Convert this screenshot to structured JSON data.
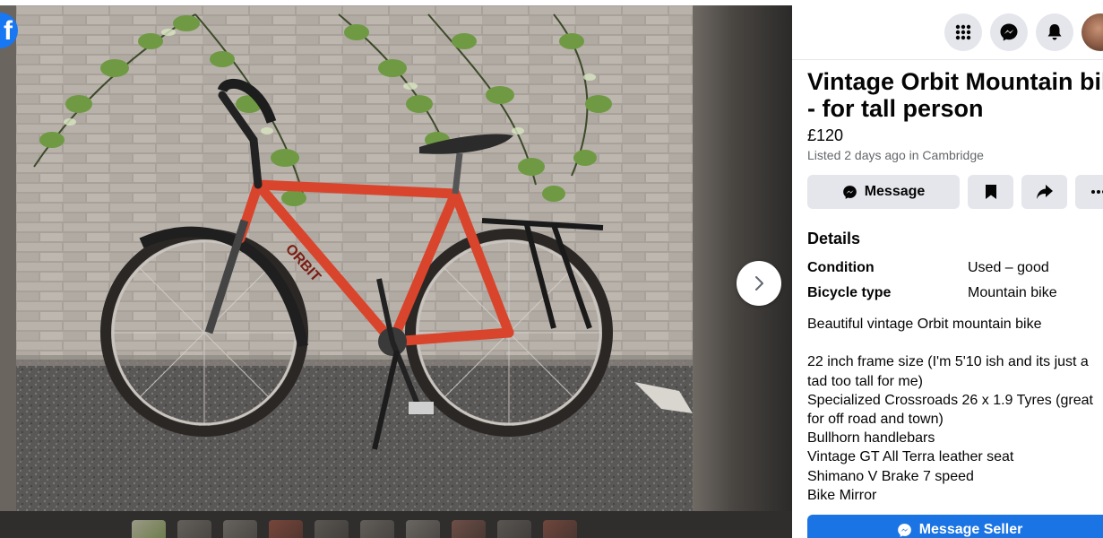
{
  "listing": {
    "title": "Vintage Orbit Mountain bike\n- for tall person",
    "title_line1": "Vintage Orbit Mountain bike",
    "title_line2": "- for tall person",
    "price": "£120",
    "listed": "Listed 2 days ago in Cambridge"
  },
  "actions": {
    "message_label": "Message"
  },
  "details": {
    "heading": "Details",
    "rows": [
      {
        "key": "Condition",
        "value": "Used – good"
      },
      {
        "key": "Bicycle type",
        "value": "Mountain bike"
      }
    ],
    "description": "Beautiful vintage Orbit mountain bike\n\n22 inch frame size (I'm 5'10 ish and its just a tad too tall for me)\nSpecialized Crossroads 26 x 1.9 Tyres (great for off road and town)\nBullhorn handlebars\nVintage GT All Terra leather seat\nShimano V Brake 7 speed\nBike Mirror"
  },
  "footer": {
    "message_seller_label": "Message Seller"
  },
  "photo": {
    "frame_brand": "ORBIT"
  },
  "colors": {
    "accent": "#1b74e4",
    "button_gray": "#e4e6eb",
    "frame_red": "#d9452c",
    "muted_text": "#65676b"
  },
  "icons": [
    "facebook-logo-icon",
    "chevron-right-icon",
    "menu-grid-icon",
    "messenger-icon",
    "bell-icon",
    "bookmark-icon",
    "share-icon",
    "more-icon"
  ]
}
